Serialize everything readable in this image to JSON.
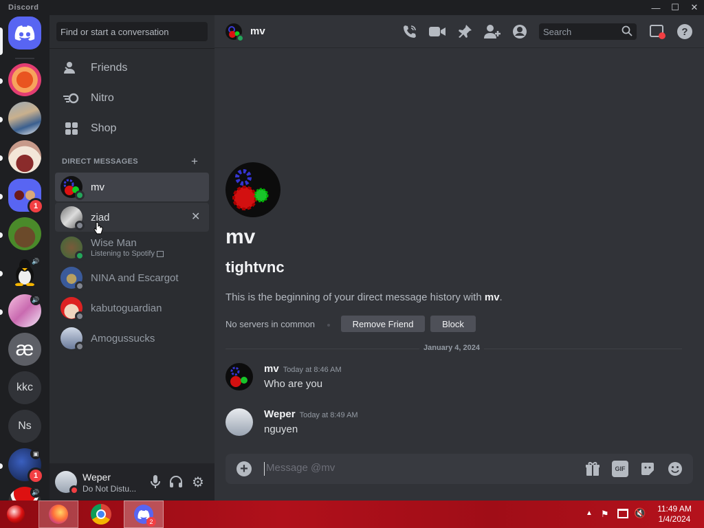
{
  "window": {
    "title": "Discord",
    "minimize": "—",
    "maximize": "☐",
    "close": "✕"
  },
  "guilds": {
    "kkc_label": "kkc",
    "ns_label": "Ns",
    "ae_label": "æ",
    "badge_server": "1",
    "badge_bottom": "1"
  },
  "sidebar": {
    "search_placeholder": "Find or start a conversation",
    "nav": [
      {
        "label": "Friends",
        "icon": "friends-icon"
      },
      {
        "label": "Nitro",
        "icon": "nitro-icon"
      },
      {
        "label": "Shop",
        "icon": "shop-icon"
      }
    ],
    "dm_header": "DIRECT MESSAGES",
    "dms": [
      {
        "name": "mv",
        "status": "online",
        "active": true
      },
      {
        "name": "ziad",
        "status": "offline",
        "hover": true
      },
      {
        "name": "Wise Man",
        "status": "online",
        "activity": "Listening to Spotify"
      },
      {
        "name": "NINA and Escargot",
        "status": "offline"
      },
      {
        "name": "kabutoguardian",
        "status": "offline"
      },
      {
        "name": "Amogussucks",
        "status": "offline"
      }
    ]
  },
  "user": {
    "name": "Weper",
    "status": "Do Not Distu..."
  },
  "header": {
    "channel_name": "mv",
    "search_placeholder": "Search"
  },
  "intro": {
    "name": "mv",
    "username": "tightvnc",
    "description_prefix": "This is the beginning of your direct message history with ",
    "description_name": "mv",
    "description_suffix": ".",
    "no_servers": "No servers in common",
    "remove_friend": "Remove Friend",
    "block": "Block"
  },
  "date_divider": "January 4, 2024",
  "messages": [
    {
      "author": "mv",
      "time": "Today at 8:46 AM",
      "text": "Who are you"
    },
    {
      "author": "Weper",
      "time": "Today at 8:49 AM",
      "text": "nguyen"
    }
  ],
  "composer": {
    "placeholder": "Message @mv"
  },
  "taskbar": {
    "time": "11:49 AM",
    "date": "1/4/2024",
    "discord_badge": "2"
  },
  "colors": {
    "online": "#23a55a",
    "offline": "#80848e",
    "dnd": "#f23f43",
    "blurple": "#5865f2",
    "button": "#4e5058"
  }
}
